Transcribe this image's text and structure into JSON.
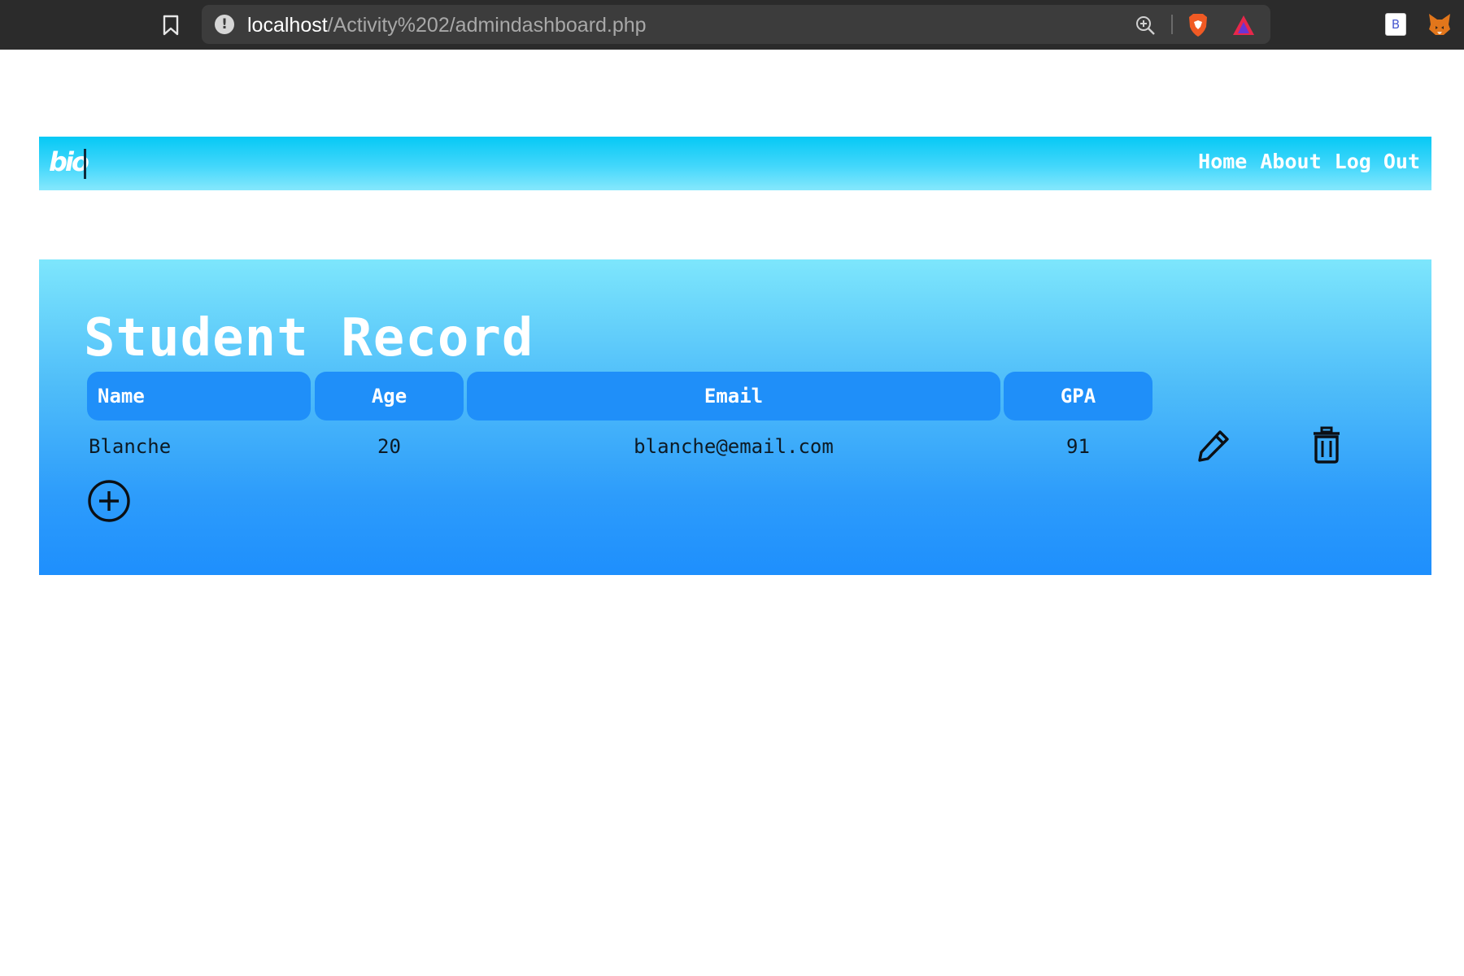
{
  "browser": {
    "url_host": "localhost",
    "url_path": "/Activity%202/admindashboard.php",
    "icons": [
      "bookmark-icon",
      "site-info-icon",
      "zoom-icon",
      "brave-shield-icon",
      "brave-rewards-icon",
      "extension-b-icon",
      "metamask-fox-icon"
    ],
    "extension_label": "B"
  },
  "navbar": {
    "logo": "bio",
    "links": [
      "Home",
      "About",
      "Log Out"
    ]
  },
  "record": {
    "title": "Student Record",
    "columns": [
      "Name",
      "Age",
      "Email",
      "GPA"
    ],
    "rows": [
      {
        "name": "Blanche",
        "age": "20",
        "email": "blanche@email.com",
        "gpa": "91",
        "actions": [
          "edit-icon",
          "delete-icon"
        ]
      }
    ],
    "add_icon": "add-circle-icon"
  },
  "colors": {
    "navbar_top": "#06c9f5",
    "panel_top": "#7de6fc",
    "panel_bottom": "#1e8ffd",
    "header_cell": "#1f8ff9"
  }
}
